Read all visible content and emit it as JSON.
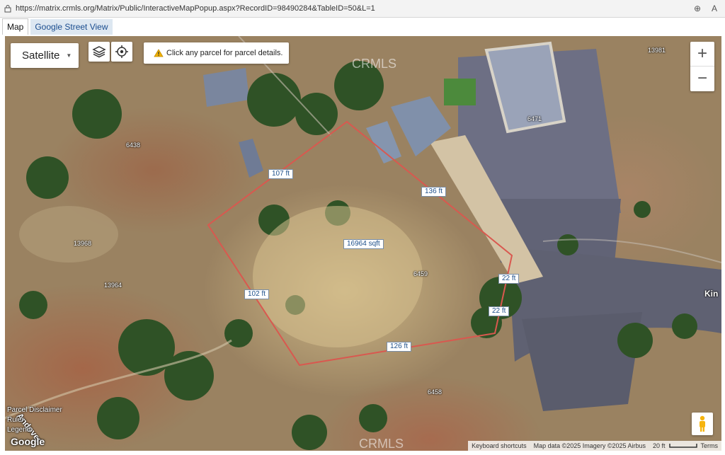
{
  "browser": {
    "url": "https://matrix.crmls.org/Matrix/Public/InteractiveMapPopup.aspx?RecordID=98490284&TableID=50&L=1"
  },
  "tabs": [
    {
      "label": "Map"
    },
    {
      "label": "Google Street View"
    }
  ],
  "map_type": {
    "label": "Satellite"
  },
  "notice": {
    "text": "Click any parcel for parcel details."
  },
  "zoom": {
    "in": "+",
    "out": "−"
  },
  "measurements": {
    "north": "107 ft",
    "northeast": "136 ft",
    "area": "16964 sqft",
    "east_top": "22 ft",
    "east_bottom": "22 ft",
    "west": "102 ft",
    "south": "126 ft"
  },
  "parcels": [
    "13981",
    "6471",
    "6438",
    "13968",
    "13964",
    "6459",
    "6458"
  ],
  "side_links": {
    "disclaimer": "Parcel Disclaimer",
    "ruler": "Ruler",
    "legend": "Legend"
  },
  "street_labels": {
    "andover": "Andover",
    "kim": "Kin"
  },
  "footer": {
    "keyboard": "Keyboard shortcuts",
    "mapdata": "Map data ©2025 Imagery ©2025 Airbus",
    "scale": "20 ft",
    "terms": "Terms"
  },
  "brand": "Google",
  "watermark": "CRMLS",
  "colors": {
    "parcel_outline": "#d9584f",
    "label_text": "#1d4f8a",
    "warning": "#f2b200"
  }
}
